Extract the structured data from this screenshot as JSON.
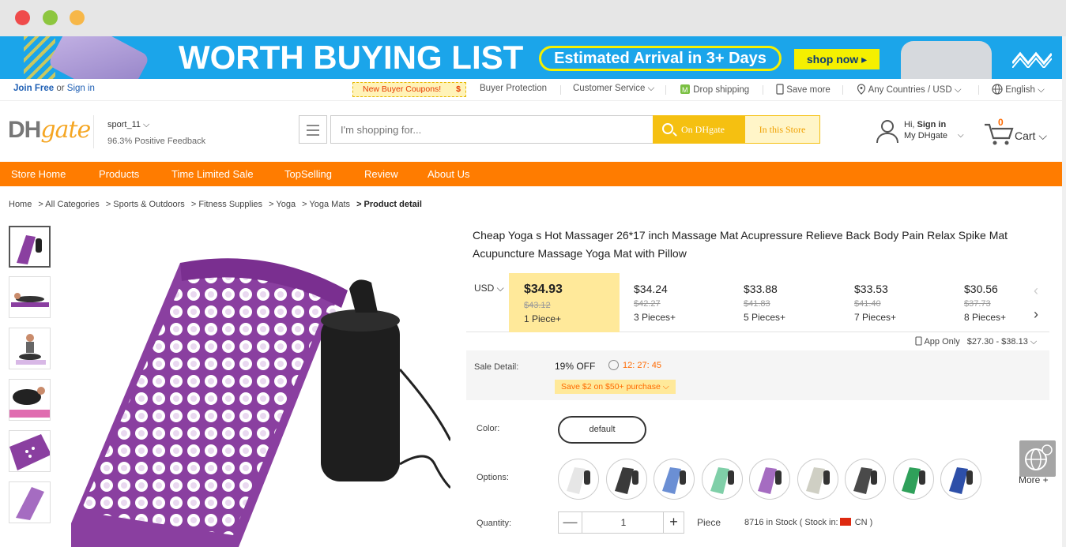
{
  "banner": {
    "headline": "WORTH BUYING LIST",
    "pill": "Estimated Arrival in 3+ Days",
    "cta": "shop now ▸"
  },
  "topbar": {
    "join": "Join Free",
    "or": "or",
    "signin": "Sign in",
    "coupon": "New Buyer Coupons!",
    "coupon_symbol": "$",
    "buyer_protection": "Buyer Protection",
    "customer_service": "Customer Service ⌵",
    "drop_shipping": "Drop shipping",
    "save_more": "Save more",
    "countries": "Any Countries / USD ⌵",
    "language": "English ⌵"
  },
  "header": {
    "logo_dh": "DH",
    "logo_gate": "gate",
    "store_name": "sport_11 ⌵",
    "feedback_pct": "96.3%",
    "feedback_label": "Positive Feedback",
    "search_placeholder": "I'm shopping for...",
    "search_dh": "On DHgate",
    "search_store": "In this Store",
    "greeting": "Hi,",
    "signin": "Sign in",
    "my_dhgate": "My DHgate",
    "cart_count": "0",
    "cart_label": "Cart ⌵"
  },
  "nav": [
    "Store Home",
    "Products",
    "Time Limited Sale",
    "TopSelling",
    "Review",
    "About Us"
  ],
  "breadcrumb": [
    "Home",
    "> All Categories",
    "> Sports & Outdoors",
    "> Fitness Supplies",
    "> Yoga",
    "> Yoga Mats",
    "> Product detail"
  ],
  "product": {
    "title": "Cheap Yoga s Hot Massager 26*17 inch Massage Mat Acupressure Relieve Back Body Pain Relax Spike Mat Acupuncture Massage Yoga Mat with Pillow",
    "currency": "USD ⌵",
    "tiers": [
      {
        "price": "$34.93",
        "orig": "$43.12",
        "qty": "1 Piece+"
      },
      {
        "price": "$34.24",
        "orig": "$42.27",
        "qty": "3 Pieces+"
      },
      {
        "price": "$33.88",
        "orig": "$41.83",
        "qty": "5 Pieces+"
      },
      {
        "price": "$33.53",
        "orig": "$41.40",
        "qty": "7 Pieces+"
      },
      {
        "price": "$30.56",
        "orig": "$37.73",
        "qty": "8 Pieces+"
      }
    ],
    "app_only": "App Only",
    "app_range": "$27.30 - $38.13 ⌵",
    "sale_label": "Sale Detail:",
    "sale_off": "19% OFF",
    "timer": "12: 27: 45",
    "save": "Save $2 on $50+ purchase ⌵",
    "color_label": "Color:",
    "color_value": "default",
    "options_label": "Options:",
    "more": "More +",
    "quantity_label": "Quantity:",
    "quantity": "1",
    "minus": "—",
    "plus": "+",
    "unit": "Piece",
    "stock": "8716 in Stock ( Stock in:",
    "stock_country": "CN )"
  },
  "colors": {
    "accent_orange": "#ff7c00",
    "search_yellow": "#f5c011",
    "banner_blue": "#1ba5ea",
    "mat_purple": "#8a3fa0"
  },
  "option_swatches": [
    "#e6e6e6",
    "#3a3a3a",
    "#6b8fd4",
    "#7fcfa8",
    "#a56cc1",
    "#cfcfc4",
    "#4a4a4a",
    "#2fa05a",
    "#2d4fa8"
  ]
}
